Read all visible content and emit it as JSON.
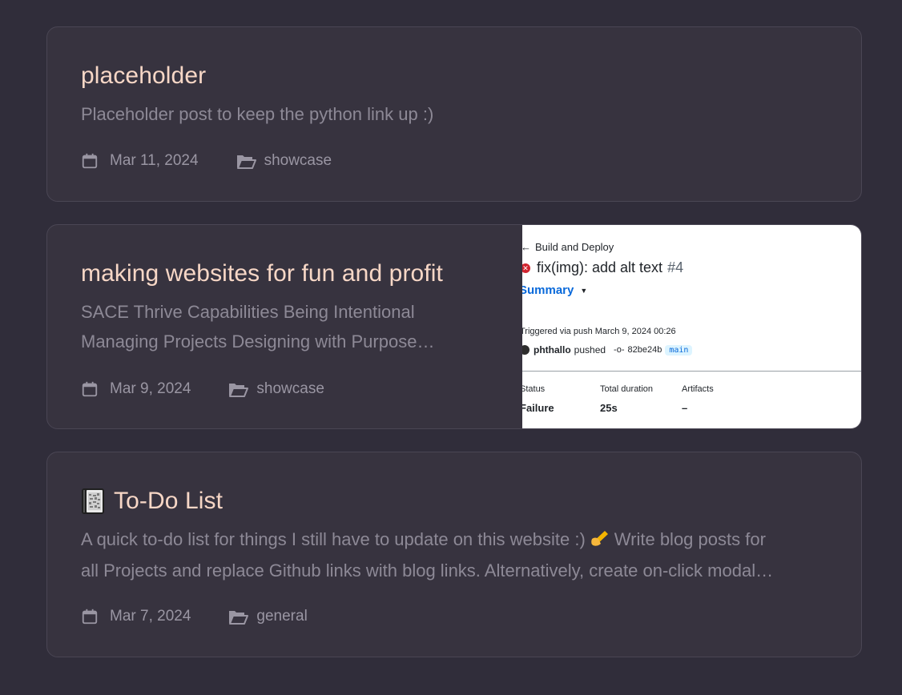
{
  "posts": [
    {
      "title": "placeholder",
      "excerpt_lines": [
        "Placeholder post to keep the python link up :)"
      ],
      "date": "Mar 11, 2024",
      "category": "showcase",
      "icons": {
        "date": "calendar-icon",
        "category": "folder-open-icon"
      }
    },
    {
      "title": "making websites for fun and profit",
      "excerpt_lines": [
        "SACE Thrive Capabilities Being Intentional",
        "Managing Projects Designing with Purpose…"
      ],
      "date": "Mar 9, 2024",
      "category": "showcase",
      "icons": {
        "date": "calendar-icon",
        "category": "folder-open-icon"
      },
      "thumbnail": {
        "back_label": "Build and Deploy",
        "run_title": "fix(img): add alt text",
        "run_number": "#4",
        "summary_label": "Summary",
        "trigger_text": "Triggered via push March 9, 2024 00:26",
        "actor": "phthallo",
        "action": "pushed",
        "commit": "82be24b",
        "branch": "main",
        "columns": [
          {
            "label": "Status",
            "value": "Failure"
          },
          {
            "label": "Total duration",
            "value": "25s"
          },
          {
            "label": "Artifacts",
            "value": "–"
          }
        ],
        "colors": {
          "failure": "#d1242f",
          "link": "#0969da"
        }
      }
    },
    {
      "title": "To-Do List",
      "title_icon": "notebook-emoji-icon",
      "excerpt_lines": [
        "A quick to-do list for things I still have to update on this website :)",
        "all Projects and replace Github links with blog links. Alternatively, create on-click modal…"
      ],
      "excerpt_inline_icon": "writing-hand-emoji-icon",
      "excerpt_line1_tail": "Write blog posts for",
      "date": "Mar 7, 2024",
      "category": "general",
      "icons": {
        "date": "calendar-icon",
        "category": "folder-open-icon"
      }
    }
  ],
  "colors": {
    "background": "#302d3a",
    "card": "#37333f",
    "title": "#f7d7c6",
    "excerpt": "#8d8996",
    "meta": "#9a96a3"
  }
}
